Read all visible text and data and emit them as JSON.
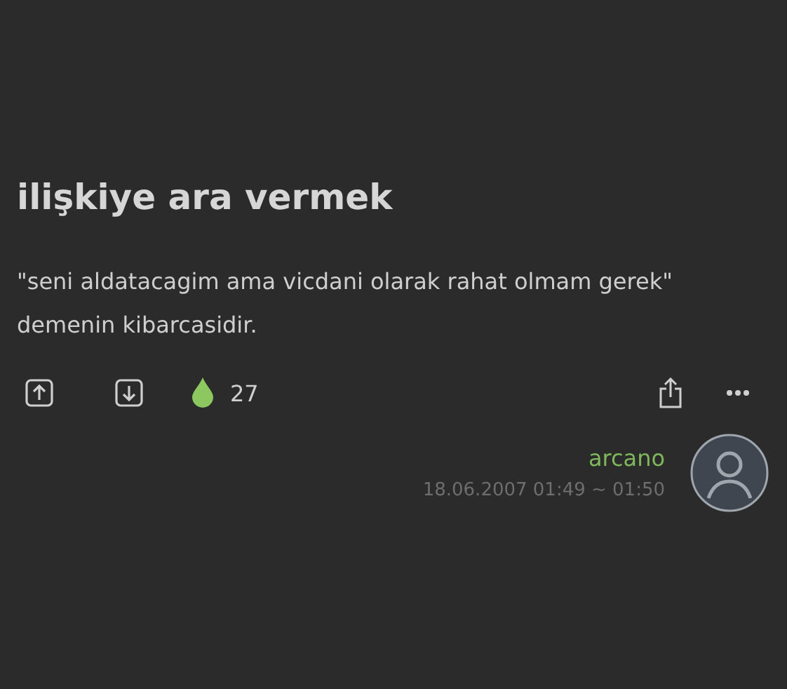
{
  "title": "ilişkiye ara vermek",
  "body": "\"seni aldatacagim ama vicdani olarak rahat olmam gerek\" demenin kibarcasidir.",
  "actions": {
    "favorite_count": "27"
  },
  "author": {
    "name": "arcano",
    "date": "18.06.2007 01:49 ~ 01:50"
  }
}
